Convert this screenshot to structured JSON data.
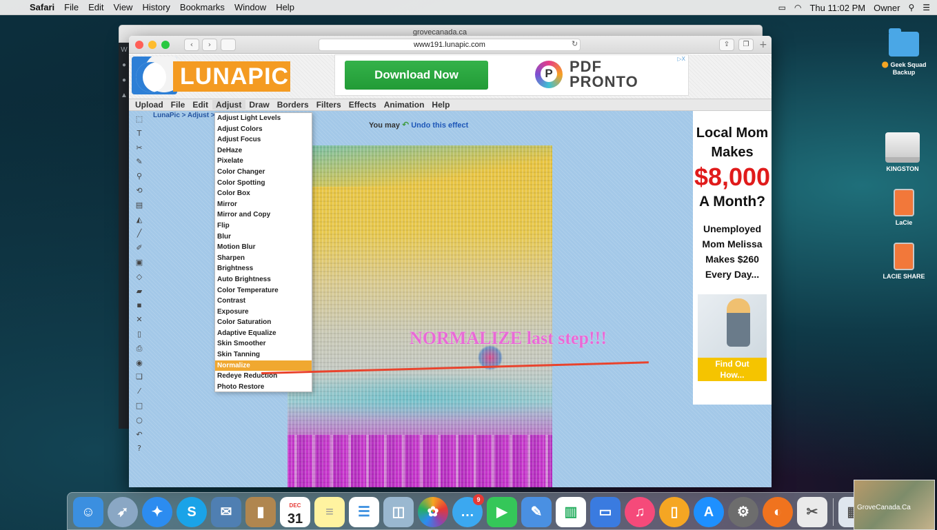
{
  "menubar": {
    "app": "Safari",
    "items": [
      "File",
      "Edit",
      "View",
      "History",
      "Bookmarks",
      "Window",
      "Help"
    ],
    "clock": "Thu 11:02 PM",
    "user": "Owner"
  },
  "back_window": {
    "url": "grovecanada.ca"
  },
  "browser": {
    "url": "www191.lunapic.com"
  },
  "lunapic": {
    "logo_text": "LUNAPIC",
    "menu": [
      "Upload",
      "File",
      "Edit",
      "Adjust",
      "Draw",
      "Borders",
      "Filters",
      "Effects",
      "Animation",
      "Help"
    ],
    "breadcrumb": "LunaPic > Adjust >",
    "undo_prefix": "You may",
    "undo_link": "Undo this effect",
    "adjust_menu": [
      "Adjust Light Levels",
      "Adjust Colors",
      "Adjust Focus",
      "DeHaze",
      "Pixelate",
      "Color Changer",
      "Color Spotting",
      "Color Box",
      "Mirror",
      "Mirror and Copy",
      "Flip",
      "Blur",
      "Motion Blur",
      "Sharpen",
      "Brightness",
      "Auto Brightness",
      "Color Temperature",
      "Contrast",
      "Exposure",
      "Color Saturation",
      "Adaptive Equalize",
      "Skin Smoother",
      "Skin Tanning",
      "Normalize",
      "Redeye Reduction",
      "Photo Restore"
    ],
    "highlighted_item": "Normalize",
    "annotation": "NORMALIZE last step!!!"
  },
  "ad_top": {
    "button": "Download Now",
    "brand_line1": "PDF",
    "brand_line2": "PRONTO",
    "adchoices": "▷X"
  },
  "ad_side": {
    "line1": "Local Mom",
    "line2": "Makes",
    "amount": "$8,000",
    "line3": "A Month?",
    "line4": "Unemployed",
    "line5": "Mom Melissa",
    "line6": "Makes $260",
    "line7": "Every Day...",
    "cta1": "Find Out",
    "cta2": "How..."
  },
  "desktop": {
    "icons": [
      "Geek Squad Backup",
      "KINGSTON",
      "LaCie",
      "LACIE SHARE"
    ]
  },
  "dock": {
    "calendar_month": "DEC",
    "calendar_day": "31",
    "messages_badge": "9",
    "thumbnail_label": "GroveCanada.Ca"
  },
  "colors": {
    "accent_orange": "#f0a830",
    "annotation_pink": "#e86ad6",
    "annotation_line": "#e9432d",
    "ad_red": "#e01b1b"
  }
}
